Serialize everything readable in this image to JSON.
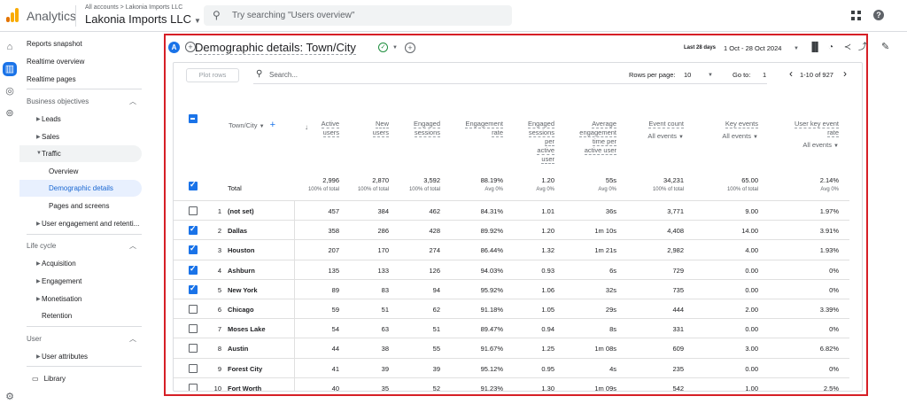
{
  "app": {
    "name": "Analytics",
    "breadcrumb": "All accounts > Lakonia Imports LLC",
    "account": "Lakonia Imports LLC",
    "search_placeholder": "Try searching \"Users overview\""
  },
  "sidebar": {
    "top_items": [
      "Reports snapshot",
      "Realtime overview",
      "Realtime pages"
    ],
    "sections": {
      "business": "Business objectives",
      "lifecycle": "Life cycle",
      "user": "User"
    },
    "business_items": [
      "Leads",
      "Sales",
      "Traffic"
    ],
    "traffic_sub": [
      "Overview",
      "Demographic details",
      "Pages and screens"
    ],
    "engagement_item": "User engagement and retenti...",
    "lifecycle_items": [
      "Acquisition",
      "Engagement",
      "Monetisation",
      "Retention"
    ],
    "user_items": [
      "User attributes"
    ],
    "library": "Library"
  },
  "report": {
    "badge": "A",
    "title": "Demographic details: Town/City",
    "date_label": "Last 28 days",
    "date_range": "1 Oct - 28 Oct 2024",
    "plot_rows": "Plot rows",
    "search_placeholder": "Search...",
    "rows_per_page_label": "Rows per page:",
    "rows_per_page": "10",
    "goto_label": "Go to:",
    "goto_value": "1",
    "page_info": "1-10 of 927"
  },
  "table": {
    "dimension_header": "Town/City",
    "headers": [
      {
        "lines": [
          "Active",
          "users"
        ]
      },
      {
        "lines": [
          "New",
          "users"
        ]
      },
      {
        "lines": [
          "Engaged",
          "sessions"
        ]
      },
      {
        "lines": [
          "Engagement",
          "rate"
        ]
      },
      {
        "lines": [
          "Engaged",
          "sessions",
          "per",
          "active",
          "user"
        ]
      },
      {
        "lines": [
          "Average",
          "engagement",
          "time per",
          "active user"
        ]
      },
      {
        "lines": [
          "Event count"
        ],
        "sub": "All events"
      },
      {
        "lines": [
          "Key events"
        ],
        "sub": "All events"
      },
      {
        "lines": [
          "User key event",
          "rate"
        ],
        "sub": "All events"
      }
    ],
    "total": {
      "label": "Total",
      "values": [
        "2,996",
        "2,870",
        "3,592",
        "88.19%",
        "1.20",
        "55s",
        "34,231",
        "65.00",
        "2.14%"
      ],
      "subs": [
        "100% of total",
        "100% of total",
        "100% of total",
        "Avg 0%",
        "Avg 0%",
        "Avg 0%",
        "100% of total",
        "100% of total",
        "Avg 0%"
      ]
    },
    "rows": [
      {
        "idx": "1",
        "city": "(not set)",
        "checked": false,
        "values": [
          "457",
          "384",
          "462",
          "84.31%",
          "1.01",
          "36s",
          "3,771",
          "9.00",
          "1.97%"
        ]
      },
      {
        "idx": "2",
        "city": "Dallas",
        "checked": true,
        "values": [
          "358",
          "286",
          "428",
          "89.92%",
          "1.20",
          "1m 10s",
          "4,408",
          "14.00",
          "3.91%"
        ]
      },
      {
        "idx": "3",
        "city": "Houston",
        "checked": true,
        "values": [
          "207",
          "170",
          "274",
          "86.44%",
          "1.32",
          "1m 21s",
          "2,982",
          "4.00",
          "1.93%"
        ]
      },
      {
        "idx": "4",
        "city": "Ashburn",
        "checked": true,
        "values": [
          "135",
          "133",
          "126",
          "94.03%",
          "0.93",
          "6s",
          "729",
          "0.00",
          "0%"
        ]
      },
      {
        "idx": "5",
        "city": "New York",
        "checked": true,
        "values": [
          "89",
          "83",
          "94",
          "95.92%",
          "1.06",
          "32s",
          "735",
          "0.00",
          "0%"
        ]
      },
      {
        "idx": "6",
        "city": "Chicago",
        "checked": false,
        "values": [
          "59",
          "51",
          "62",
          "91.18%",
          "1.05",
          "29s",
          "444",
          "2.00",
          "3.39%"
        ]
      },
      {
        "idx": "7",
        "city": "Moses Lake",
        "checked": false,
        "values": [
          "54",
          "63",
          "51",
          "89.47%",
          "0.94",
          "8s",
          "331",
          "0.00",
          "0%"
        ]
      },
      {
        "idx": "8",
        "city": "Austin",
        "checked": false,
        "values": [
          "44",
          "38",
          "55",
          "91.67%",
          "1.25",
          "1m 08s",
          "609",
          "3.00",
          "6.82%"
        ]
      },
      {
        "idx": "9",
        "city": "Forest City",
        "checked": false,
        "values": [
          "41",
          "39",
          "39",
          "95.12%",
          "0.95",
          "4s",
          "235",
          "0.00",
          "0%"
        ]
      },
      {
        "idx": "10",
        "city": "Fort Worth",
        "checked": false,
        "values": [
          "40",
          "35",
          "52",
          "91.23%",
          "1.30",
          "1m 09s",
          "542",
          "1.00",
          "2.5%"
        ]
      }
    ]
  },
  "colors": {
    "accent": "#1a73e8",
    "highlight_frame": "#d61f26",
    "selected_nav_bg": "#e8f0fe",
    "logo_orange": "#f9ab00",
    "logo_dark": "#e37400"
  }
}
